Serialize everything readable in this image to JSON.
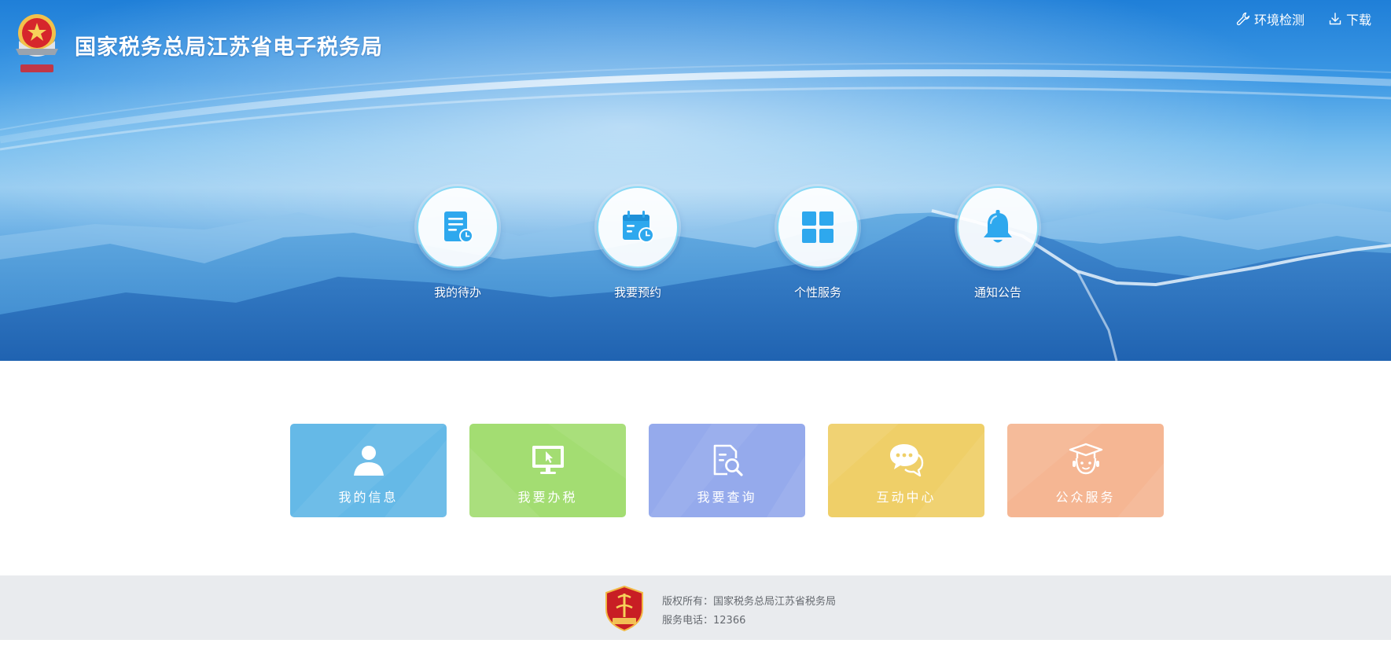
{
  "header": {
    "site_title": "国家税务总局江苏省电子税务局",
    "links": [
      {
        "label": "环境检测",
        "icon": "wrench-icon"
      },
      {
        "label": "下载",
        "icon": "download-icon"
      }
    ]
  },
  "quick_access": [
    {
      "label": "我的待办",
      "icon": "todo-document-icon"
    },
    {
      "label": "我要预约",
      "icon": "calendar-clock-icon"
    },
    {
      "label": "个性服务",
      "icon": "grid-icon"
    },
    {
      "label": "通知公告",
      "icon": "bell-icon"
    }
  ],
  "tiles": [
    {
      "label": "我的信息",
      "icon": "user-icon",
      "color": "#65b9e7"
    },
    {
      "label": "我要办税",
      "icon": "monitor-cursor-icon",
      "color": "#a3dd72"
    },
    {
      "label": "我要查询",
      "icon": "document-search-icon",
      "color": "#95aaec"
    },
    {
      "label": "互动中心",
      "icon": "chat-bubbles-icon",
      "color": "#efcf68"
    },
    {
      "label": "公众服务",
      "icon": "graduate-support-icon",
      "color": "#f5b693"
    }
  ],
  "footer": {
    "copyright": "版权所有：国家税务总局江苏省税务局",
    "phone": "服务电话：12366"
  },
  "colors": {
    "banner_blue": "#1f7fd8",
    "icon_blue": "#2ea8ee",
    "footer_bg": "#e9ebee"
  }
}
